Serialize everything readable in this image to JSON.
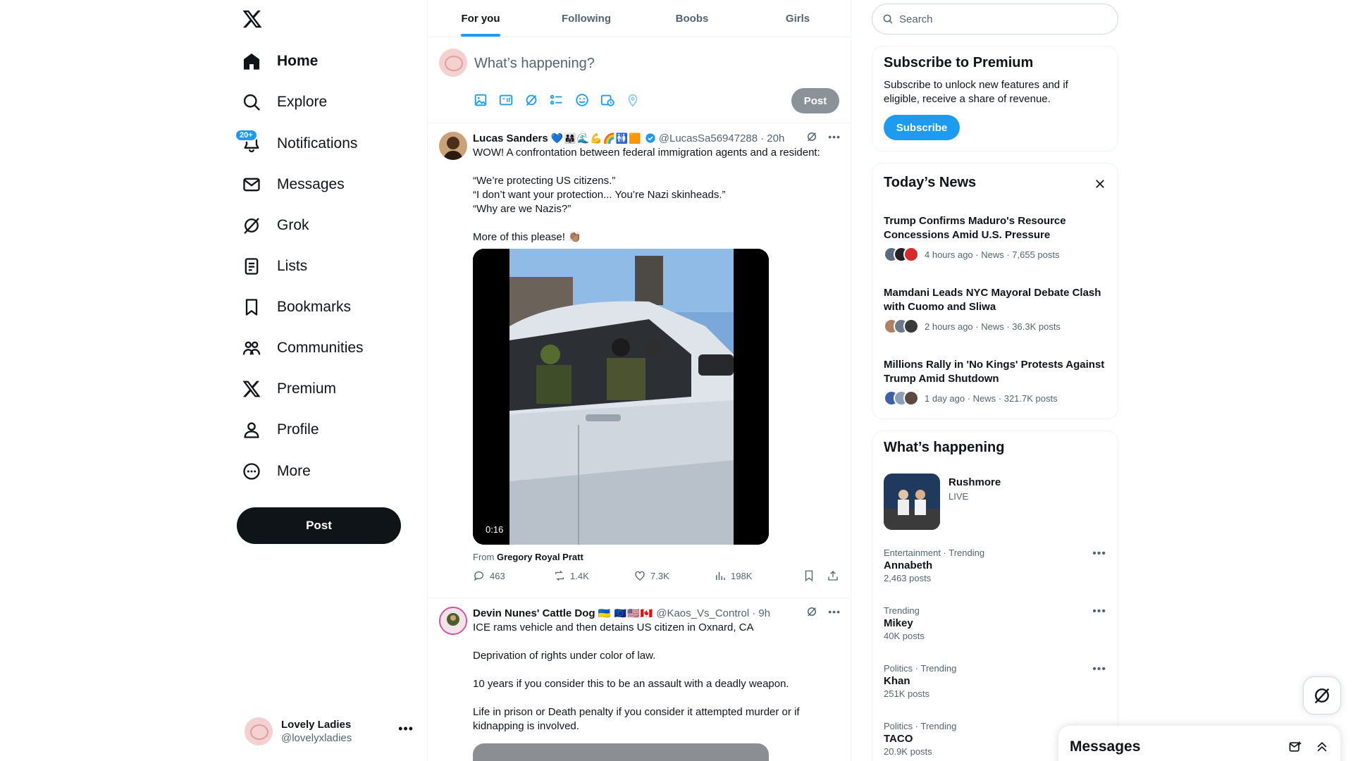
{
  "nav": {
    "items": [
      {
        "label": "Home",
        "icon": "home-icon"
      },
      {
        "label": "Explore",
        "icon": "search-icon"
      },
      {
        "label": "Notifications",
        "icon": "bell-icon",
        "badge": "20+"
      },
      {
        "label": "Messages",
        "icon": "envelope-icon"
      },
      {
        "label": "Grok",
        "icon": "grok-icon"
      },
      {
        "label": "Lists",
        "icon": "list-icon"
      },
      {
        "label": "Bookmarks",
        "icon": "bookmark-icon"
      },
      {
        "label": "Communities",
        "icon": "communities-icon"
      },
      {
        "label": "Premium",
        "icon": "x-icon"
      },
      {
        "label": "Profile",
        "icon": "person-icon"
      },
      {
        "label": "More",
        "icon": "more-circle-icon"
      }
    ],
    "post_label": "Post",
    "account": {
      "name": "Lovely Ladies",
      "handle": "@lovelyxladies"
    }
  },
  "tabs": [
    "For you",
    "Following",
    "Boobs",
    "Girls"
  ],
  "compose": {
    "placeholder": "What’s happening?",
    "post_label": "Post"
  },
  "tweets": [
    {
      "name": "Lucas Sanders",
      "emojis": "💙👨‍👩‍👧🌊💪🌈🚻🟧",
      "handle": "@LucasSa56947288",
      "time": "· 20h",
      "lines": [
        "WOW! A confrontation between federal immigration agents and a resident:",
        "",
        "“We’re protecting US citizens.”",
        "“I don’t want your protection... You’re Nazi skinheads.”",
        "“Why are we Nazis?”",
        "",
        "More of this please! 👏🏽"
      ],
      "video_duration": "0:16",
      "from_prefix": "From",
      "from_name": "Gregory Royal Pratt",
      "replies": "463",
      "reposts": "1.4K",
      "likes": "7.3K",
      "views": "198K"
    },
    {
      "name": "Devin Nunes' Cattle Dog",
      "emojis": "🇺🇦 🇪🇺🇺🇸🇨🇦",
      "handle": "@Kaos_Vs_Control",
      "time": "· 9h",
      "lines": [
        "ICE rams vehicle and then detains US citizen in Oxnard, CA",
        "",
        "Deprivation of rights under color of law.",
        "",
        "10 years if you consider this to be an assault with a deadly weapon.",
        "",
        "Life in prison or Death penalty if you consider it attempted murder or if kidnapping is involved."
      ]
    }
  ],
  "right": {
    "search_placeholder": "Search",
    "premium": {
      "title": "Subscribe to Premium",
      "text": "Subscribe to unlock new features and if eligible, receive a share of revenue.",
      "button": "Subscribe"
    },
    "news": {
      "title": "Today’s News",
      "items": [
        {
          "title": "Trump Confirms Maduro's Resource Concessions Amid U.S. Pressure",
          "meta": "4 hours ago · News · 7,655 posts"
        },
        {
          "title": "Mamdani Leads NYC Mayoral Debate Clash with Cuomo and Sliwa",
          "meta": "2 hours ago · News · 36.3K posts"
        },
        {
          "title": "Millions Rally in 'No Kings' Protests Against Trump Amid Shutdown",
          "meta": "1 day ago · News · 321.7K posts"
        }
      ]
    },
    "happening": {
      "title": "What’s happening",
      "live": {
        "name": "Rushmore",
        "status": "LIVE"
      },
      "trends": [
        {
          "category": "Entertainment · Trending",
          "name": "Annabeth",
          "count": "2,463 posts"
        },
        {
          "category": "Trending",
          "name": "Mikey",
          "count": "40K posts"
        },
        {
          "category": "Politics · Trending",
          "name": "Khan",
          "count": "251K posts"
        },
        {
          "category": "Politics · Trending",
          "name": "TACO",
          "count": "20.9K posts"
        }
      ]
    }
  },
  "drawer": {
    "title": "Messages"
  },
  "colors": {
    "accent": "#1d9bf0",
    "text": "#0f1419",
    "muted": "#536471",
    "border": "#eff3f4"
  }
}
